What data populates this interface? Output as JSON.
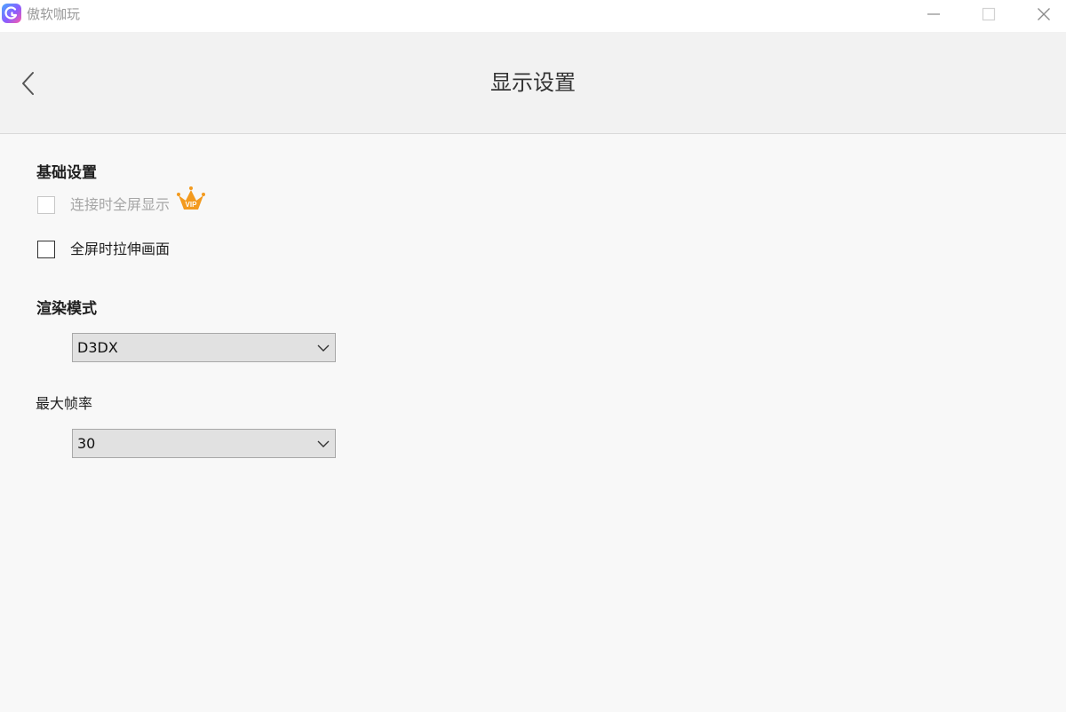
{
  "window": {
    "app_title": "傲软咖玩",
    "minimize_icon": "minimize-icon",
    "maximize_icon": "maximize-icon",
    "close_icon": "close-icon"
  },
  "header": {
    "back_icon": "chevron-left-icon",
    "title": "显示设置"
  },
  "basic": {
    "section_title": "基础设置",
    "fullscreen_on_connect": {
      "label": "连接时全屏显示",
      "checked": false,
      "disabled": true,
      "badge_icon": "vip-crown-icon",
      "badge_text": "VIP"
    },
    "stretch_fullscreen": {
      "label": "全屏时拉伸画面",
      "checked": false,
      "disabled": false
    }
  },
  "render": {
    "section_title": "渲染模式",
    "selected": "D3DX"
  },
  "framerate": {
    "section_title": "最大帧率",
    "selected": "30"
  },
  "colors": {
    "accent_vip": "#f39a1e",
    "header_bg": "#f2f2f2",
    "content_bg": "#f8f8f8",
    "select_bg": "#e1e1e1"
  }
}
